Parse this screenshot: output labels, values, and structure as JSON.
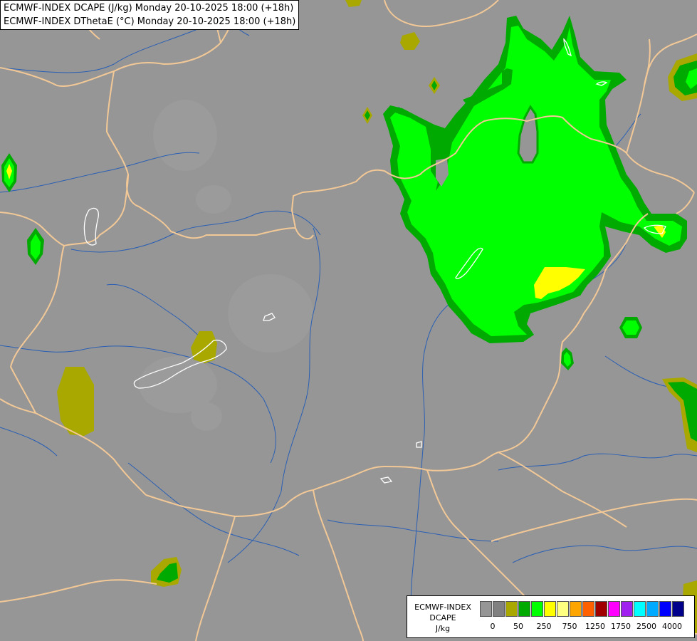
{
  "title": {
    "line1": "ECMWF-INDEX DCAPE (J/kg) Monday 20-10-2025 18:00 (+18h)",
    "line2": "ECMWF-INDEX DThetaE (°C) Monday 20-10-2025 18:00 (+18h)"
  },
  "map": {
    "background_color": "#969696",
    "border_color": "#f2c896",
    "river_color": "#2a5fb4",
    "lake_outline_color": "#ffffff",
    "fill_colors": {
      "olive": "#a8a800",
      "dark_green": "#00aa00",
      "bright_green": "#00ff00",
      "yellow": "#ffff00"
    }
  },
  "legend": {
    "title_line1": "ECMWF-INDEX",
    "title_line2": "DCAPE",
    "unit": "J/kg",
    "swatch_colors": [
      "#969696",
      "#808080",
      "#a8a800",
      "#00aa00",
      "#00ff00",
      "#ffff00",
      "#ffff80",
      "#ffa500",
      "#ff6000",
      "#a00000",
      "#ff00ff",
      "#a020f0",
      "#00ffff",
      "#00aaff",
      "#0000ff",
      "#00008b"
    ],
    "tick_labels": [
      "0",
      "50",
      "250",
      "750",
      "1250",
      "1750",
      "2500",
      "4000"
    ]
  }
}
